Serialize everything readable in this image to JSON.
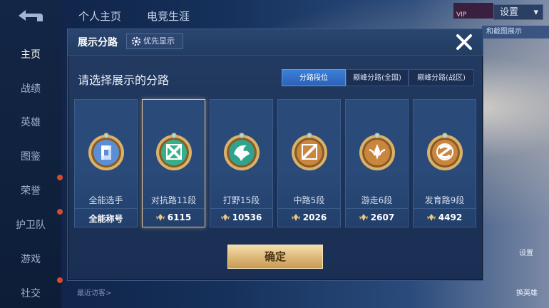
{
  "background": {
    "top_tabs": [
      "个人主页",
      "电竞生涯"
    ],
    "settings_label": "设置",
    "sidebar_items": [
      {
        "label": "主页",
        "active": true
      },
      {
        "label": "战绩"
      },
      {
        "label": "英雄"
      },
      {
        "label": "图鉴",
        "dot": true
      },
      {
        "label": "荣誉",
        "dot": true
      },
      {
        "label": "护卫队",
        "dot": true
      },
      {
        "label": "游戏"
      },
      {
        "label": "社交",
        "dot": true
      }
    ],
    "banner_text": "VIP",
    "side_button": "和截图展示",
    "bottom_hint": "最近访客>",
    "right_icons": [
      "设置",
      "换英雄"
    ]
  },
  "modal": {
    "title": "展示分路",
    "priority_label": "优先显示",
    "subtitle": "请选择展示的分路",
    "segments": [
      {
        "label": "分路段位",
        "active": true
      },
      {
        "label": "巅峰分路(全国)",
        "active": false
      },
      {
        "label": "巅峰分路(战区)",
        "active": false
      }
    ],
    "cards": [
      {
        "name": "全能选手",
        "score": "全能称号",
        "has_icon": false,
        "selected": false,
        "emblem": "all-round-emblem-icon",
        "color": "#5a8fd6"
      },
      {
        "name": "对抗路11段",
        "score": "6115",
        "has_icon": true,
        "selected": true,
        "emblem": "clash-lane-emblem-icon",
        "color": "#35b08a"
      },
      {
        "name": "打野15段",
        "score": "10536",
        "has_icon": true,
        "selected": false,
        "emblem": "jungle-emblem-icon",
        "color": "#2fa38c"
      },
      {
        "name": "中路5段",
        "score": "2026",
        "has_icon": true,
        "selected": false,
        "emblem": "mid-lane-emblem-icon",
        "color": "#c9863f"
      },
      {
        "name": "游走6段",
        "score": "2607",
        "has_icon": true,
        "selected": false,
        "emblem": "roam-emblem-icon",
        "color": "#c9863f"
      },
      {
        "name": "发育路9段",
        "score": "4492",
        "has_icon": true,
        "selected": false,
        "emblem": "farm-lane-emblem-icon",
        "color": "#c9863f"
      }
    ],
    "confirm_label": "确定"
  }
}
